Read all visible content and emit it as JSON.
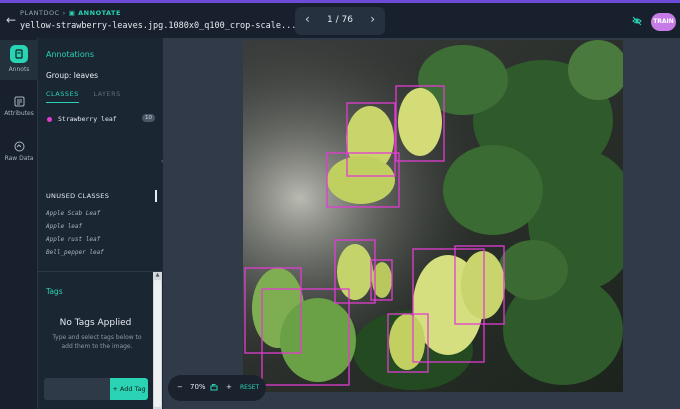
{
  "header": {
    "crumb_project": "PLANTDOC",
    "crumb_mode": "ANNOTATE",
    "filename": "yellow-strawberry-leaves.jpg.1080x0_q100_crop-scale...",
    "page_counter": "1 / 76",
    "train_label": "TRAIN"
  },
  "rail": [
    {
      "label": "Annots",
      "icon": "annotations-icon",
      "active": true
    },
    {
      "label": "Attributes",
      "icon": "list-icon",
      "active": false
    },
    {
      "label": "Raw Data",
      "icon": "raw-data-icon",
      "active": false
    }
  ],
  "panel": {
    "title": "Annotations",
    "group": "Group: leaves",
    "tab_classes": "CLASSES",
    "tab_layers": "LAYERS",
    "classes": [
      {
        "name": "Strawberry leaf",
        "count": "10",
        "color": "#e13cd2"
      }
    ],
    "unused_title": "UNUSED CLASSES",
    "unused": [
      "Apple Scab Leaf",
      "Apple leaf",
      "Apple rust leaf",
      "Bell_pepper leaf"
    ],
    "tags_title": "Tags",
    "no_tags": "No Tags Applied",
    "tags_help": "Type and select tags below to add them to the image.",
    "add_tag": "+ Add Tag",
    "add_tag_placeholder": ""
  },
  "zoom": {
    "value": "70%",
    "minus": "−",
    "plus": "+",
    "reset": "RESET"
  },
  "colors": {
    "accent": "#29d3b4",
    "box": "#e13cd2",
    "train": "#c77be6",
    "progress": "#6b4bd8"
  }
}
